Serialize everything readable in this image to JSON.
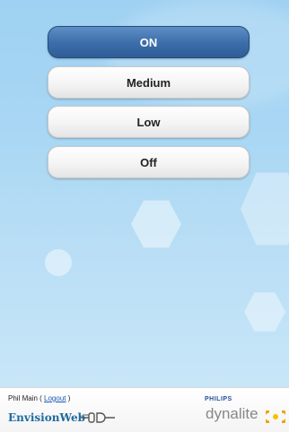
{
  "buttons": [
    {
      "label": "ON",
      "active": true
    },
    {
      "label": "Medium",
      "active": false
    },
    {
      "label": "Low",
      "active": false
    },
    {
      "label": "Off",
      "active": false
    }
  ],
  "footer": {
    "user_name": "Phil Main",
    "logout_label": "Logout",
    "brand_left": "EnvisionWeb",
    "brand_right_top": "PHILIPS",
    "brand_right_main": "dynalite",
    "icons": [
      "plug-icon",
      "dynalite-logo-icon"
    ]
  },
  "colors": {
    "background": "#a9d7f4",
    "active_button": "#3d6fab",
    "envision_text": "#1f6a9e",
    "philips_text": "#1f4fa0"
  }
}
